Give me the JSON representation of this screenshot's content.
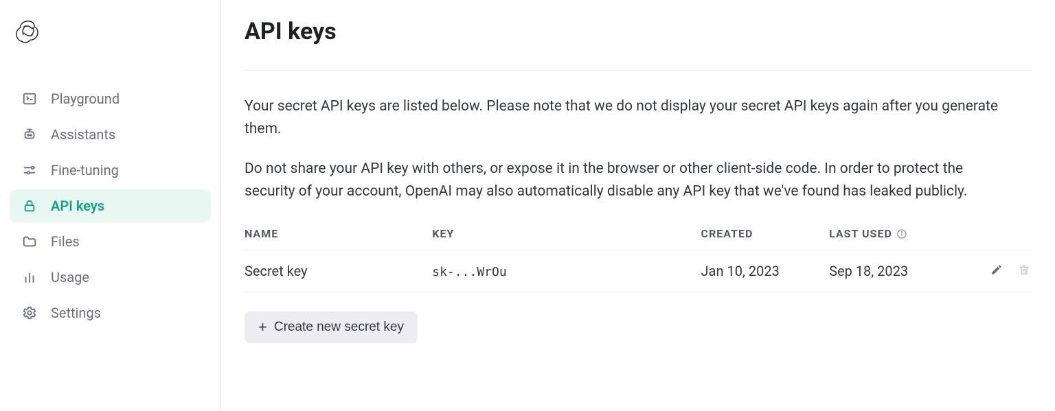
{
  "sidebar": {
    "items": [
      {
        "label": "Playground",
        "active": false
      },
      {
        "label": "Assistants",
        "active": false
      },
      {
        "label": "Fine-tuning",
        "active": false
      },
      {
        "label": "API keys",
        "active": true
      },
      {
        "label": "Files",
        "active": false
      },
      {
        "label": "Usage",
        "active": false
      },
      {
        "label": "Settings",
        "active": false
      }
    ]
  },
  "header": {
    "title": "API keys"
  },
  "intro": {
    "p1": "Your secret API keys are listed below. Please note that we do not display your secret API keys again after you generate them.",
    "p2": "Do not share your API key with others, or expose it in the browser or other client-side code. In order to protect the security of your account, OpenAI may also automatically disable any API key that we've found has leaked publicly."
  },
  "table": {
    "headers": {
      "name": "NAME",
      "key": "KEY",
      "created": "CREATED",
      "last_used": "LAST USED"
    },
    "rows": [
      {
        "name": "Secret key",
        "key": "sk-...WrOu",
        "created": "Jan 10, 2023",
        "last_used": "Sep 18, 2023"
      }
    ]
  },
  "actions": {
    "create_label": "Create new secret key"
  }
}
